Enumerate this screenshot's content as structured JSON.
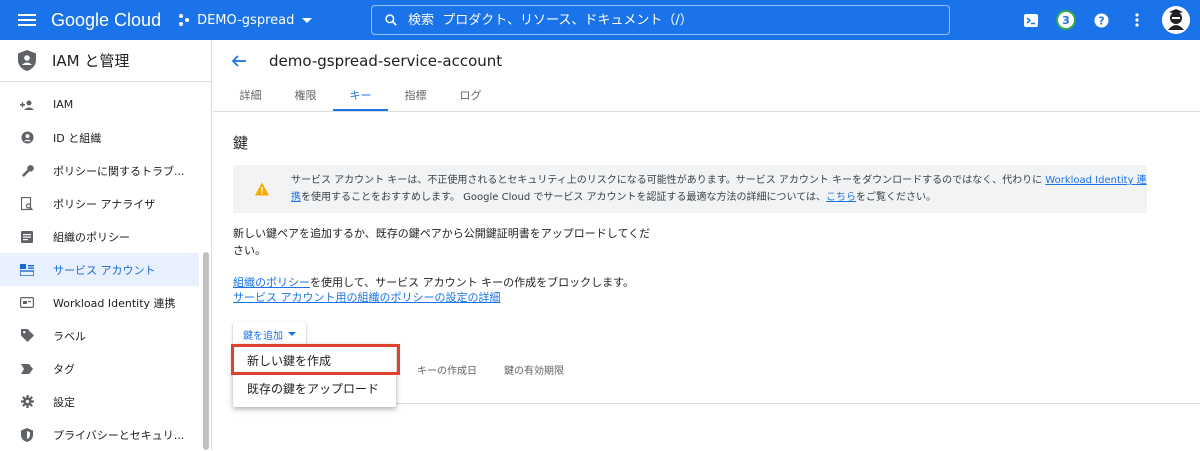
{
  "topbar": {
    "logo": "Google Cloud",
    "project": "DEMO-gspread",
    "search_placeholder": "検索  プロダクト、リソース、ドキュメント（/）",
    "notification_count": "3"
  },
  "sidebar": {
    "title": "IAM と管理",
    "items": [
      {
        "label": "IAM",
        "icon": "person-add-icon"
      },
      {
        "label": "ID と組織",
        "icon": "account-circle-icon"
      },
      {
        "label": "ポリシーに関するトラブ...",
        "icon": "wrench-icon"
      },
      {
        "label": "ポリシー アナライザ",
        "icon": "doc-search-icon"
      },
      {
        "label": "組織のポリシー",
        "icon": "list-doc-icon"
      },
      {
        "label": "サービス アカウント",
        "icon": "service-account-icon",
        "active": true
      },
      {
        "label": "Workload Identity 連携",
        "icon": "id-card-icon"
      },
      {
        "label": "ラベル",
        "icon": "label-icon"
      },
      {
        "label": "タグ",
        "icon": "tag-icon"
      },
      {
        "label": "設定",
        "icon": "gear-icon"
      },
      {
        "label": "プライバシーとセキュリ...",
        "icon": "shield-icon"
      }
    ]
  },
  "main": {
    "title": "demo-gspread-service-account",
    "tabs": [
      "詳細",
      "権限",
      "キー",
      "指標",
      "ログ"
    ],
    "active_tab": 2,
    "section_title": "鍵",
    "warning": {
      "part1": "サービス アカウント キーは、不正使用されるとセキュリティ上のリスクになる可能性があります。サービス アカウント キーをダウンロードするのではなく、代わりに ",
      "link1": "Workload Identity 連携",
      "part2": "を使用することをおすすめします。 Google Cloud でサービス アカウントを認証する最適な方法の詳細については、",
      "link2": "こちら",
      "part3": "をご覧ください。"
    },
    "description": "新しい鍵ペアを追加するか、既存の鍵ペアから公開鍵証明書をアップロードしてください。",
    "policy_link": "組織のポリシー",
    "policy_text": "を使用して、サービス アカウント キーの作成をブロックします。",
    "policy_detail_link": "サービス アカウント用の組織のポリシーの設定の詳細",
    "add_key_button": "鍵を追加",
    "table_headers": [
      "キーの作成日",
      "鍵の有効期限"
    ],
    "menu": [
      "新しい鍵を作成",
      "既存の鍵をアップロード"
    ]
  },
  "colors": {
    "accent": "#1a73e8",
    "highlight": "#e0412f",
    "warning": "#f9ab00"
  }
}
